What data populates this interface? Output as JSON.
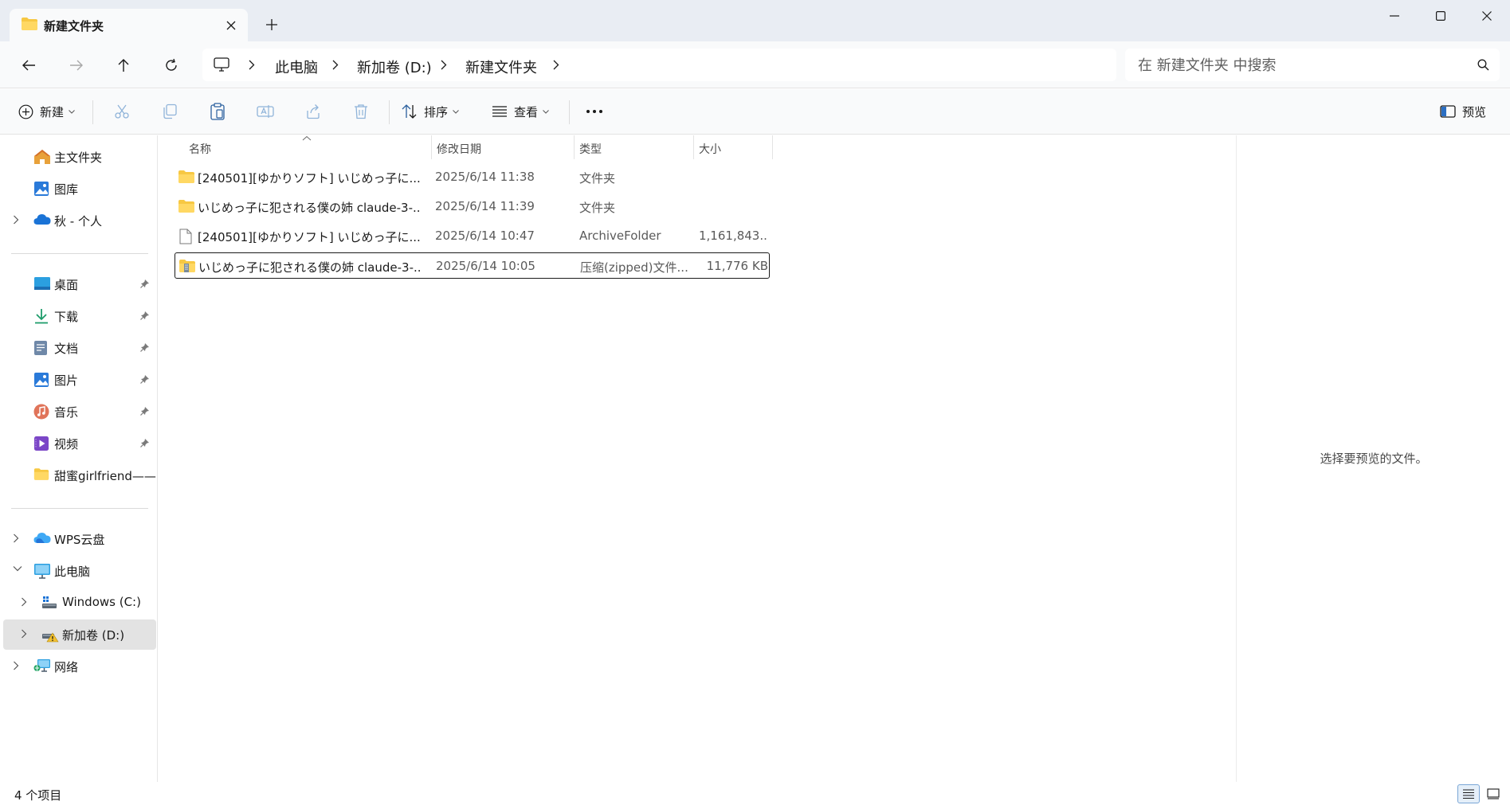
{
  "window": {
    "tab_title": "新建文件夹",
    "controls": [
      "minimize-icon",
      "maximize-icon",
      "close-icon"
    ]
  },
  "address": {
    "crumbs": [
      "此电脑",
      "新加卷 (D:)",
      "新建文件夹"
    ]
  },
  "search": {
    "placeholder": "在 新建文件夹 中搜索",
    "value": ""
  },
  "toolbar": {
    "new_label": "新建",
    "sort_label": "排序",
    "view_label": "查看",
    "preview_label": "预览",
    "icons": [
      "cut-icon",
      "copy-icon",
      "paste-icon",
      "rename-icon",
      "share-icon",
      "delete-icon",
      "more-icon"
    ]
  },
  "sidebar": {
    "quick": [
      {
        "label": "主文件夹",
        "icon": "home-icon"
      },
      {
        "label": "图库",
        "icon": "gallery-icon"
      },
      {
        "label": "秋 - 个人",
        "icon": "onedrive-icon"
      }
    ],
    "pinned": [
      {
        "label": "桌面",
        "icon": "desktop-icon"
      },
      {
        "label": "下载",
        "icon": "download-icon"
      },
      {
        "label": "文档",
        "icon": "documents-icon"
      },
      {
        "label": "图片",
        "icon": "pictures-icon"
      },
      {
        "label": "音乐",
        "icon": "music-icon"
      },
      {
        "label": "视频",
        "icon": "video-icon"
      },
      {
        "label": "甜蜜girlfriend——",
        "icon": "folder-icon"
      }
    ],
    "tree": [
      {
        "label": "WPS云盘",
        "icon": "wps-cloud-icon"
      },
      {
        "label": "此电脑",
        "icon": "this-pc-icon"
      },
      {
        "label": "Windows (C:)",
        "icon": "drive-c-icon"
      },
      {
        "label": "新加卷 (D:)",
        "icon": "drive-d-icon"
      },
      {
        "label": "网络",
        "icon": "network-icon"
      }
    ]
  },
  "filelist": {
    "columns": [
      "名称",
      "修改日期",
      "类型",
      "大小"
    ],
    "rows": [
      {
        "name": "[240501][ゆかりソフト] いじめっ子に...",
        "date": "2025/6/14 11:38",
        "type": "文件夹",
        "size": "",
        "icon": "folder-icon"
      },
      {
        "name": "いじめっ子に犯される僕の姉 claude-3-...",
        "date": "2025/6/14 11:39",
        "type": "文件夹",
        "size": "",
        "icon": "folder-icon"
      },
      {
        "name": "[240501][ゆかりソフト] いじめっ子に...",
        "date": "2025/6/14 10:47",
        "type": "ArchiveFolder",
        "size": "1,161,843...",
        "icon": "file-icon"
      },
      {
        "name": "いじめっ子に犯される僕の姉 claude-3-...",
        "date": "2025/6/14 10:05",
        "type": "压缩(zipped)文件...",
        "size": "11,776 KB",
        "icon": "zip-folder-icon"
      }
    ]
  },
  "preview": {
    "message": "选择要预览的文件。"
  },
  "status": {
    "item_count": "4 个项目"
  },
  "colors": {
    "titlebar_bg": "#e9edf3",
    "chrome_bg": "#f9fafb",
    "folder_yellow": "#f7c843",
    "selection_gray": "#e3e3e3",
    "accent_blue": "#0f6cbd"
  }
}
